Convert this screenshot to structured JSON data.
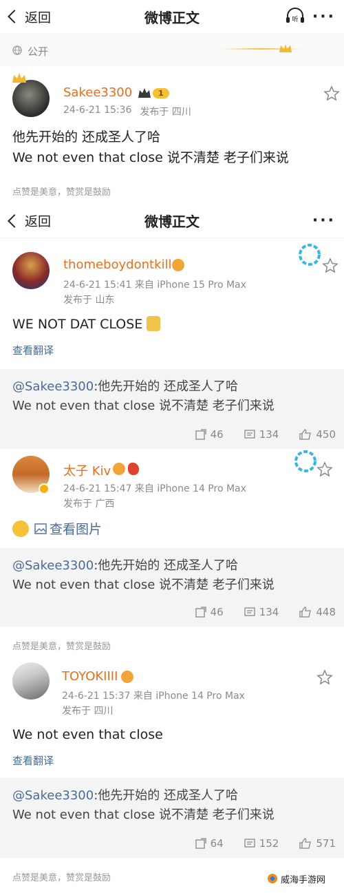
{
  "nav1": {
    "back_label": "返回",
    "title": "微博正文",
    "listen_label": "听"
  },
  "visibility": "公开",
  "post": {
    "username": "Sakee3300",
    "level": "1",
    "time": "24-6-21 15:36",
    "location": "发布于 四川",
    "line1": "他先开始的 还成圣人了哈",
    "line2": "We not even that close 说不清楚 老子们来说",
    "footer": "点赞是美意，赞赏是鼓励"
  },
  "nav2": {
    "back_label": "返回",
    "title": "微博正文"
  },
  "comments": [
    {
      "username": "thomeboydontkill",
      "time_line": "24-6-21 15:41  来自 iPhone 15 Pro Max",
      "location": "发布于 山东",
      "text": "WE NOT DAT CLOSE",
      "translate": "查看翻译",
      "quote_at": "@Sakee3300",
      "quote_rest": ":他先开始的 还成圣人了哈",
      "quote_line2": "We not even that close 说不清楚 老子们来说",
      "reposts": "46",
      "comments": "134",
      "likes": "450"
    },
    {
      "username": "太子 Kiv",
      "time_line": "24-6-21 15:47  来自 iPhone 14 Pro Max",
      "location": "发布于 广西",
      "view_image": "查看图片",
      "quote_at": "@Sakee3300",
      "quote_rest": ":他先开始的 还成圣人了哈",
      "quote_line2": "We not even that close 说不清楚 老子们来说",
      "reposts": "46",
      "comments": "134",
      "likes": "448",
      "footer": "点赞是美意，赞赏是鼓励"
    },
    {
      "username": "TOYOKIIII",
      "time_line": "24-6-21 15:37  来自 iPhone 14 Pro Max",
      "location": "发布于 四川",
      "text": "We not even that close",
      "translate": "查看翻译",
      "quote_at": "@Sakee3300",
      "quote_rest": ":他先开始的 还成圣人了哈",
      "quote_line2": "We not even that close 说不清楚 老子们来说",
      "reposts": "64",
      "comments": "152",
      "likes": "571",
      "footer": "点赞是美意，赞赏是鼓励"
    }
  ],
  "watermark": "威海手游网",
  "colors": {
    "username": "#e8701a",
    "link": "#4a6a9a",
    "band": "#f4f4f4"
  }
}
